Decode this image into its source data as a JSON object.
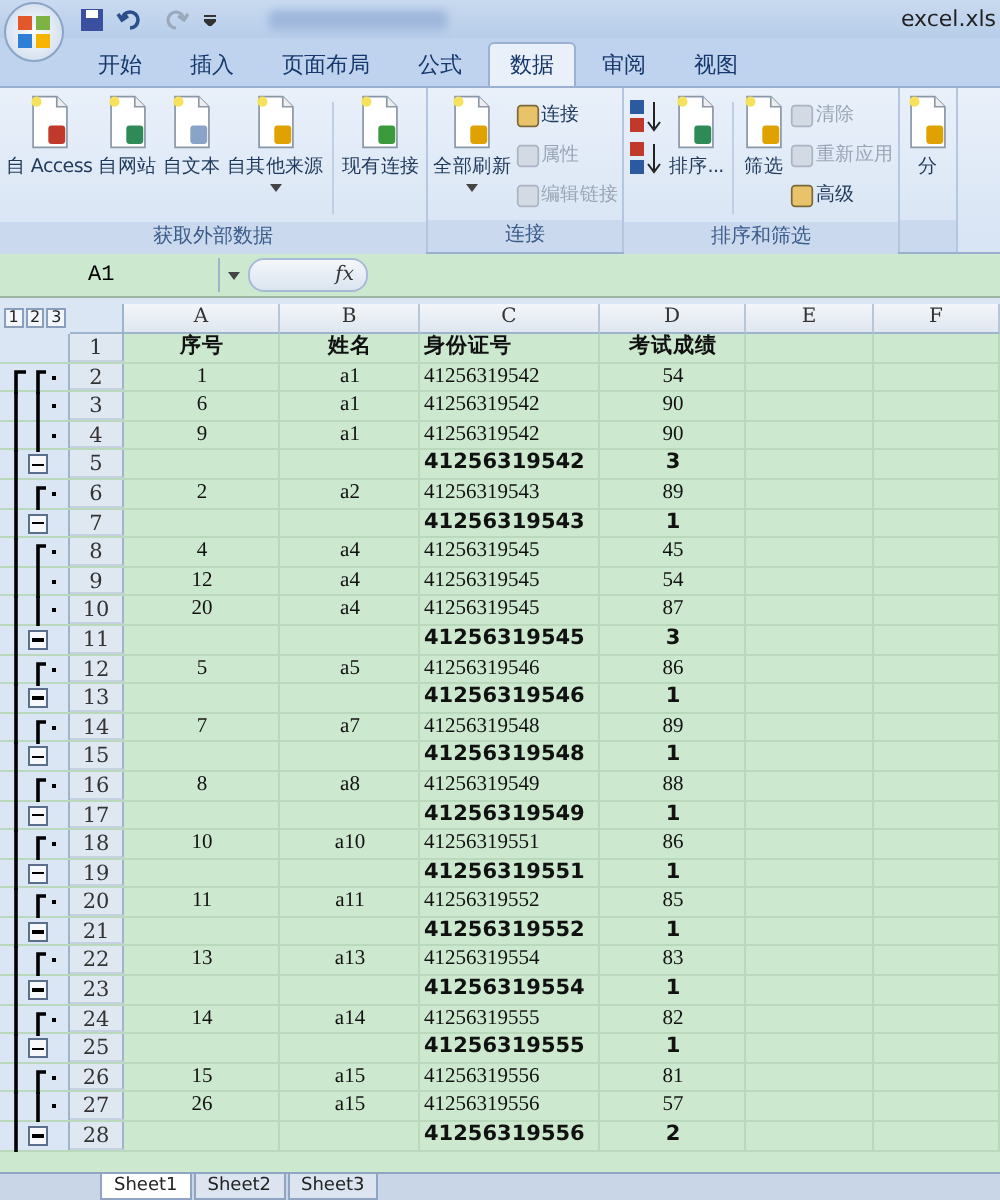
{
  "title_bar": {
    "file_name": "excel.xls"
  },
  "tabs": [
    {
      "label": "开始",
      "selected": false
    },
    {
      "label": "插入",
      "selected": false
    },
    {
      "label": "页面布局",
      "selected": false
    },
    {
      "label": "公式",
      "selected": false
    },
    {
      "label": "数据",
      "selected": true
    },
    {
      "label": "审阅",
      "selected": false
    },
    {
      "label": "视图",
      "selected": false
    }
  ],
  "ribbon_groups": [
    {
      "label": "获取外部数据",
      "columns": [
        {
          "kind": "large",
          "label": "自 Access",
          "has_menu": false,
          "disabled": false
        },
        {
          "kind": "large",
          "label": "自网站",
          "has_menu": false,
          "disabled": false
        },
        {
          "kind": "large",
          "label": "自文本",
          "has_menu": false,
          "disabled": false
        },
        {
          "kind": "large",
          "label": "自其他来源",
          "has_menu": true,
          "disabled": false
        },
        {
          "kind": "separator"
        },
        {
          "kind": "large",
          "label": "现有连接",
          "has_menu": false,
          "disabled": false
        }
      ]
    },
    {
      "label": "连接",
      "columns": [
        {
          "kind": "large",
          "label": "全部刷新",
          "has_menu": true,
          "disabled": false
        },
        {
          "kind": "stack",
          "items": [
            {
              "kind": "small",
              "label": "连接",
              "disabled": false
            },
            {
              "kind": "small",
              "label": "属性",
              "disabled": true
            },
            {
              "kind": "small",
              "label": "编辑链接",
              "disabled": true
            }
          ]
        }
      ]
    },
    {
      "label": "排序和筛选",
      "columns": [
        {
          "kind": "stack",
          "items": [
            {
              "kind": "ascending"
            },
            {
              "kind": "descending"
            }
          ]
        },
        {
          "kind": "large",
          "label": "排序...",
          "has_menu": false,
          "disabled": false
        },
        {
          "kind": "separator"
        },
        {
          "kind": "large",
          "label": "筛选",
          "has_menu": false,
          "disabled": false
        },
        {
          "kind": "stack",
          "items": [
            {
              "kind": "small",
              "label": "清除",
              "disabled": true
            },
            {
              "kind": "small",
              "label": "重新应用",
              "disabled": true
            },
            {
              "kind": "small",
              "label": "高级",
              "disabled": false
            }
          ]
        }
      ]
    },
    {
      "columns": [
        {
          "kind": "large",
          "label": "分"
        }
      ]
    }
  ],
  "formula_bar": {
    "name_box": "A1",
    "fx": "fx"
  },
  "outline_levels": [
    "1",
    "2",
    "3"
  ],
  "columns": [
    "A",
    "B",
    "C",
    "D",
    "E",
    "F"
  ],
  "rows": [
    {
      "number": "1",
      "kind": "header",
      "cells": [
        "序号",
        "姓名",
        "身份证号",
        "考试成绩"
      ]
    },
    {
      "number": "2",
      "kind": "detail",
      "cells": [
        "1",
        "a1",
        "41256319542",
        "54"
      ]
    },
    {
      "number": "3",
      "kind": "detail",
      "cells": [
        "6",
        "a1",
        "41256319542",
        "90"
      ]
    },
    {
      "number": "4",
      "kind": "detail",
      "cells": [
        "9",
        "a1",
        "41256319542",
        "90"
      ]
    },
    {
      "number": "5",
      "kind": "subtotal",
      "cells": [
        "",
        "",
        "41256319542",
        "3"
      ]
    },
    {
      "number": "6",
      "kind": "detail",
      "cells": [
        "2",
        "a2",
        "41256319543",
        "89"
      ]
    },
    {
      "number": "7",
      "kind": "subtotal",
      "cells": [
        "",
        "",
        "41256319543",
        "1"
      ]
    },
    {
      "number": "8",
      "kind": "detail",
      "cells": [
        "4",
        "a4",
        "41256319545",
        "45"
      ]
    },
    {
      "number": "9",
      "kind": "detail",
      "cells": [
        "12",
        "a4",
        "41256319545",
        "54"
      ]
    },
    {
      "number": "10",
      "kind": "detail",
      "cells": [
        "20",
        "a4",
        "41256319545",
        "87"
      ]
    },
    {
      "number": "11",
      "kind": "subtotal",
      "cells": [
        "",
        "",
        "41256319545",
        "3"
      ]
    },
    {
      "number": "12",
      "kind": "detail",
      "cells": [
        "5",
        "a5",
        "41256319546",
        "86"
      ]
    },
    {
      "number": "13",
      "kind": "subtotal",
      "cells": [
        "",
        "",
        "41256319546",
        "1"
      ]
    },
    {
      "number": "14",
      "kind": "detail",
      "cells": [
        "7",
        "a7",
        "41256319548",
        "89"
      ]
    },
    {
      "number": "15",
      "kind": "subtotal",
      "cells": [
        "",
        "",
        "41256319548",
        "1"
      ]
    },
    {
      "number": "16",
      "kind": "detail",
      "cells": [
        "8",
        "a8",
        "41256319549",
        "88"
      ]
    },
    {
      "number": "17",
      "kind": "subtotal",
      "cells": [
        "",
        "",
        "41256319549",
        "1"
      ]
    },
    {
      "number": "18",
      "kind": "detail",
      "cells": [
        "10",
        "a10",
        "41256319551",
        "86"
      ]
    },
    {
      "number": "19",
      "kind": "subtotal",
      "cells": [
        "",
        "",
        "41256319551",
        "1"
      ]
    },
    {
      "number": "20",
      "kind": "detail",
      "cells": [
        "11",
        "a11",
        "41256319552",
        "85"
      ]
    },
    {
      "number": "21",
      "kind": "subtotal",
      "cells": [
        "",
        "",
        "41256319552",
        "1"
      ]
    },
    {
      "number": "22",
      "kind": "detail",
      "cells": [
        "13",
        "a13",
        "41256319554",
        "83"
      ]
    },
    {
      "number": "23",
      "kind": "subtotal",
      "cells": [
        "",
        "",
        "41256319554",
        "1"
      ]
    },
    {
      "number": "24",
      "kind": "detail",
      "cells": [
        "14",
        "a14",
        "41256319555",
        "82"
      ]
    },
    {
      "number": "25",
      "kind": "subtotal",
      "cells": [
        "",
        "",
        "41256319555",
        "1"
      ]
    },
    {
      "number": "26",
      "kind": "detail",
      "cells": [
        "15",
        "a15",
        "41256319556",
        "81"
      ]
    },
    {
      "number": "27",
      "kind": "detail",
      "cells": [
        "26",
        "a15",
        "41256319556",
        "57"
      ]
    },
    {
      "number": "28",
      "kind": "subtotal",
      "cells": [
        "",
        "",
        "41256319556",
        "2"
      ]
    }
  ],
  "sheet_tabs": [
    {
      "label": "Sheet1",
      "selected": true
    },
    {
      "label": "Sheet2",
      "selected": false
    },
    {
      "label": "Sheet3",
      "selected": false
    }
  ]
}
